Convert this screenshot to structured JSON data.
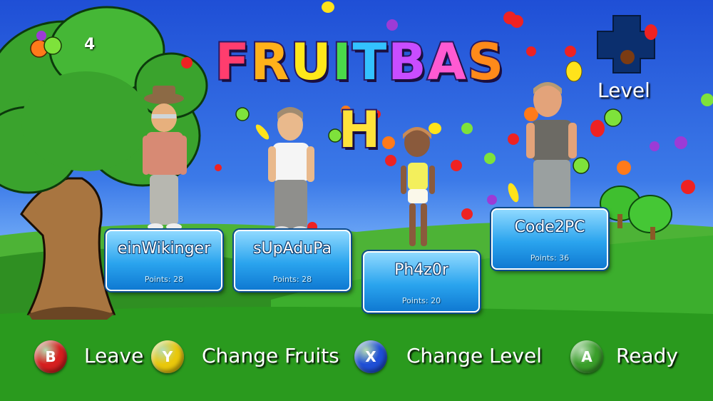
{
  "game": {
    "logo_letters": [
      "F",
      "R",
      "U",
      "I",
      "T",
      "B",
      "A",
      "S",
      "H"
    ],
    "logo_colors": [
      "#ff3d6e",
      "#ffb11a",
      "#ffe81a",
      "#4ad94a",
      "#33c2ff",
      "#c84dff",
      "#ff5ad2",
      "#ff8a1a",
      "#ffe23a"
    ],
    "fruit_counter": "4",
    "level_label": "Level"
  },
  "players": [
    {
      "name": "einWikinger",
      "points": "Points: 28"
    },
    {
      "name": "sUpAduPa",
      "points": "Points: 28"
    },
    {
      "name": "Ph4z0r",
      "points": "Points: 20"
    },
    {
      "name": "Code2PC",
      "points": "Points: 36"
    }
  ],
  "controls": [
    {
      "key": "B",
      "label": "Leave",
      "color": "#d61f1f"
    },
    {
      "key": "Y",
      "label": "Change Fruits",
      "color": "#e9c80c"
    },
    {
      "key": "X",
      "label": "Change Level",
      "color": "#1f4fd6"
    },
    {
      "key": "A",
      "label": "Ready",
      "color": "#3a9e2a"
    }
  ]
}
